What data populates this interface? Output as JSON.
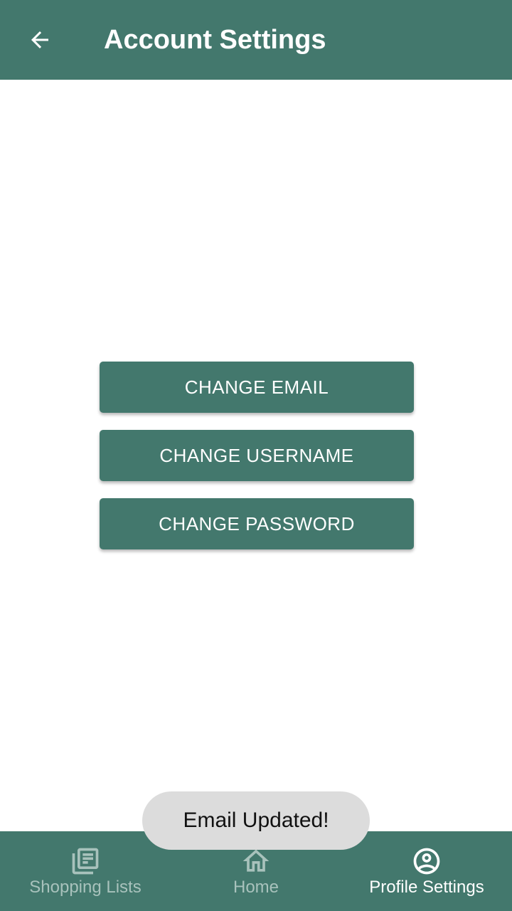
{
  "header": {
    "title": "Account Settings",
    "back_icon": "arrow-left-icon"
  },
  "actions": {
    "change_email": "CHANGE EMAIL",
    "change_username": "CHANGE USERNAME",
    "change_password": "CHANGE PASSWORD"
  },
  "toast": {
    "message": "Email Updated!"
  },
  "bottom_nav": {
    "items": [
      {
        "label": "Shopping Lists",
        "icon": "list-document-icon",
        "active": false
      },
      {
        "label": "Home",
        "icon": "home-icon",
        "active": false
      },
      {
        "label": "Profile Settings",
        "icon": "account-circle-icon",
        "active": true
      }
    ]
  },
  "colors": {
    "primary": "#43786d",
    "toast_bg": "#dcdcdc",
    "nav_inactive": "#a8c2bc",
    "nav_active": "#ffffff"
  }
}
